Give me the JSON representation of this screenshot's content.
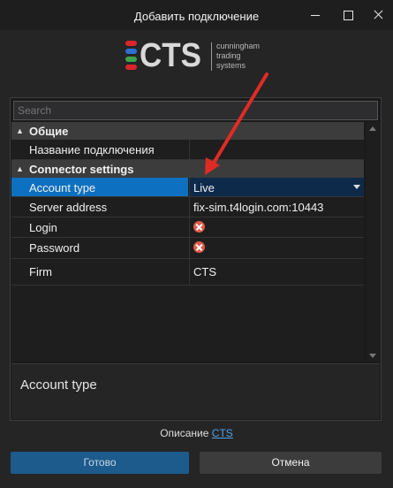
{
  "window": {
    "title": "Добавить подключение"
  },
  "logo": {
    "word": "CTS",
    "subtitle_lines": [
      "cunningham",
      "trading",
      "systems"
    ],
    "dot_colors": [
      "#d9262b",
      "#2f6fd0",
      "#3da34b",
      "#d9262b"
    ]
  },
  "search": {
    "placeholder": "Search"
  },
  "sections": {
    "general": "Общие",
    "connector": "Connector settings"
  },
  "properties": {
    "connection_name": {
      "label": "Название подключения",
      "value": ""
    },
    "account_type": {
      "label": "Account type",
      "value": "Live"
    },
    "server_address": {
      "label": "Server address",
      "value": "fix-sim.t4login.com:10443"
    },
    "login": {
      "label": "Login",
      "value": ""
    },
    "password": {
      "label": "Password",
      "value": ""
    },
    "firm": {
      "label": "Firm",
      "value": "CTS"
    }
  },
  "description": {
    "text": "Account type"
  },
  "footer": {
    "prefix": "Описание",
    "link": "CTS"
  },
  "buttons": {
    "ok": "Готово",
    "cancel": "Отмена"
  },
  "colors": {
    "selection": "#0e70c0",
    "annotation_arrow": "#e02b25",
    "error_icon": "#e05a4a",
    "link": "#4ea3e8"
  }
}
